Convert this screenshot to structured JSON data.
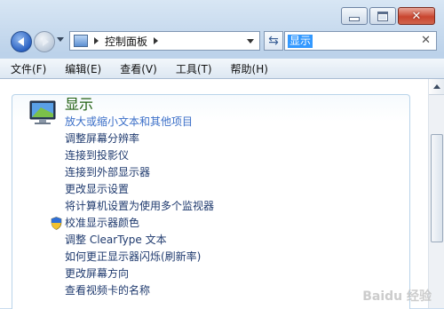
{
  "window": {
    "caption_buttons": [
      "minimize-icon",
      "maximize-icon",
      "close-icon"
    ]
  },
  "nav": {
    "address_text": "控制面板",
    "search_value": "显示",
    "clear_glyph": "✕",
    "refresh_glyph": "⇆"
  },
  "menu": {
    "items": [
      "文件(F)",
      "编辑(E)",
      "查看(V)",
      "工具(T)",
      "帮助(H)"
    ]
  },
  "section": {
    "title": "显示",
    "links": [
      "放大或缩小文本和其他项目",
      "调整屏幕分辨率",
      "连接到投影仪",
      "连接到外部显示器",
      "更改显示设置",
      "将计算机设置为使用多个监视器",
      "校准显示器颜色",
      "调整 ClearType 文本",
      "如何更正显示器闪烁(刷新率)",
      "更改屏幕方向",
      "查看视频卡的名称"
    ]
  },
  "colors": {
    "title_green": "#1e5e0f",
    "link_blue": "#1f3a6e",
    "hover_link": "#3b6fc8",
    "search_highlight": "#3399ff"
  },
  "watermark": "Baidu 经验"
}
